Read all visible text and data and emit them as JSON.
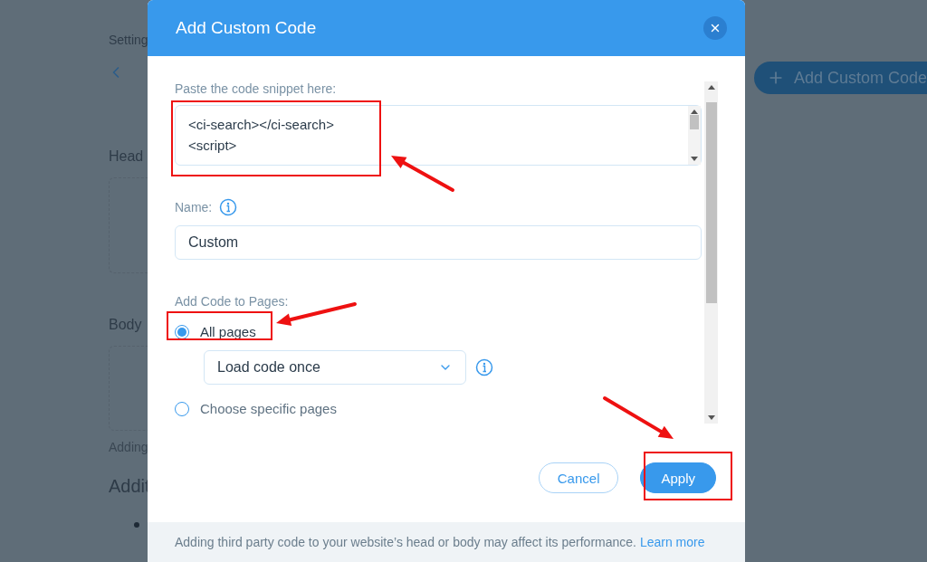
{
  "background_page": {
    "breadcrumb": "Setting",
    "sections": [
      {
        "heading": "Head"
      },
      {
        "heading": "Body"
      }
    ],
    "note": "Adding",
    "subheading": "Addit",
    "add_button": "Add Custom Code"
  },
  "dialog": {
    "title": "Add Custom Code",
    "code_label": "Paste the code snippet here:",
    "code_lines": [
      "<ci-search></ci-search>",
      "<script>"
    ],
    "name_label": "Name:",
    "name_value": "Custom",
    "pages_label": "Add Code to Pages:",
    "page_options": [
      {
        "label": "All pages",
        "selected": true
      },
      {
        "label": "Choose specific pages",
        "selected": false
      }
    ],
    "load_select": "Load code once",
    "buttons": [
      {
        "label": "Cancel",
        "kind": "secondary"
      },
      {
        "label": "Apply",
        "kind": "primary"
      }
    ],
    "footer_text": "Adding third party code to your website’s head or body may affect its performance.",
    "footer_link": "Learn more"
  }
}
